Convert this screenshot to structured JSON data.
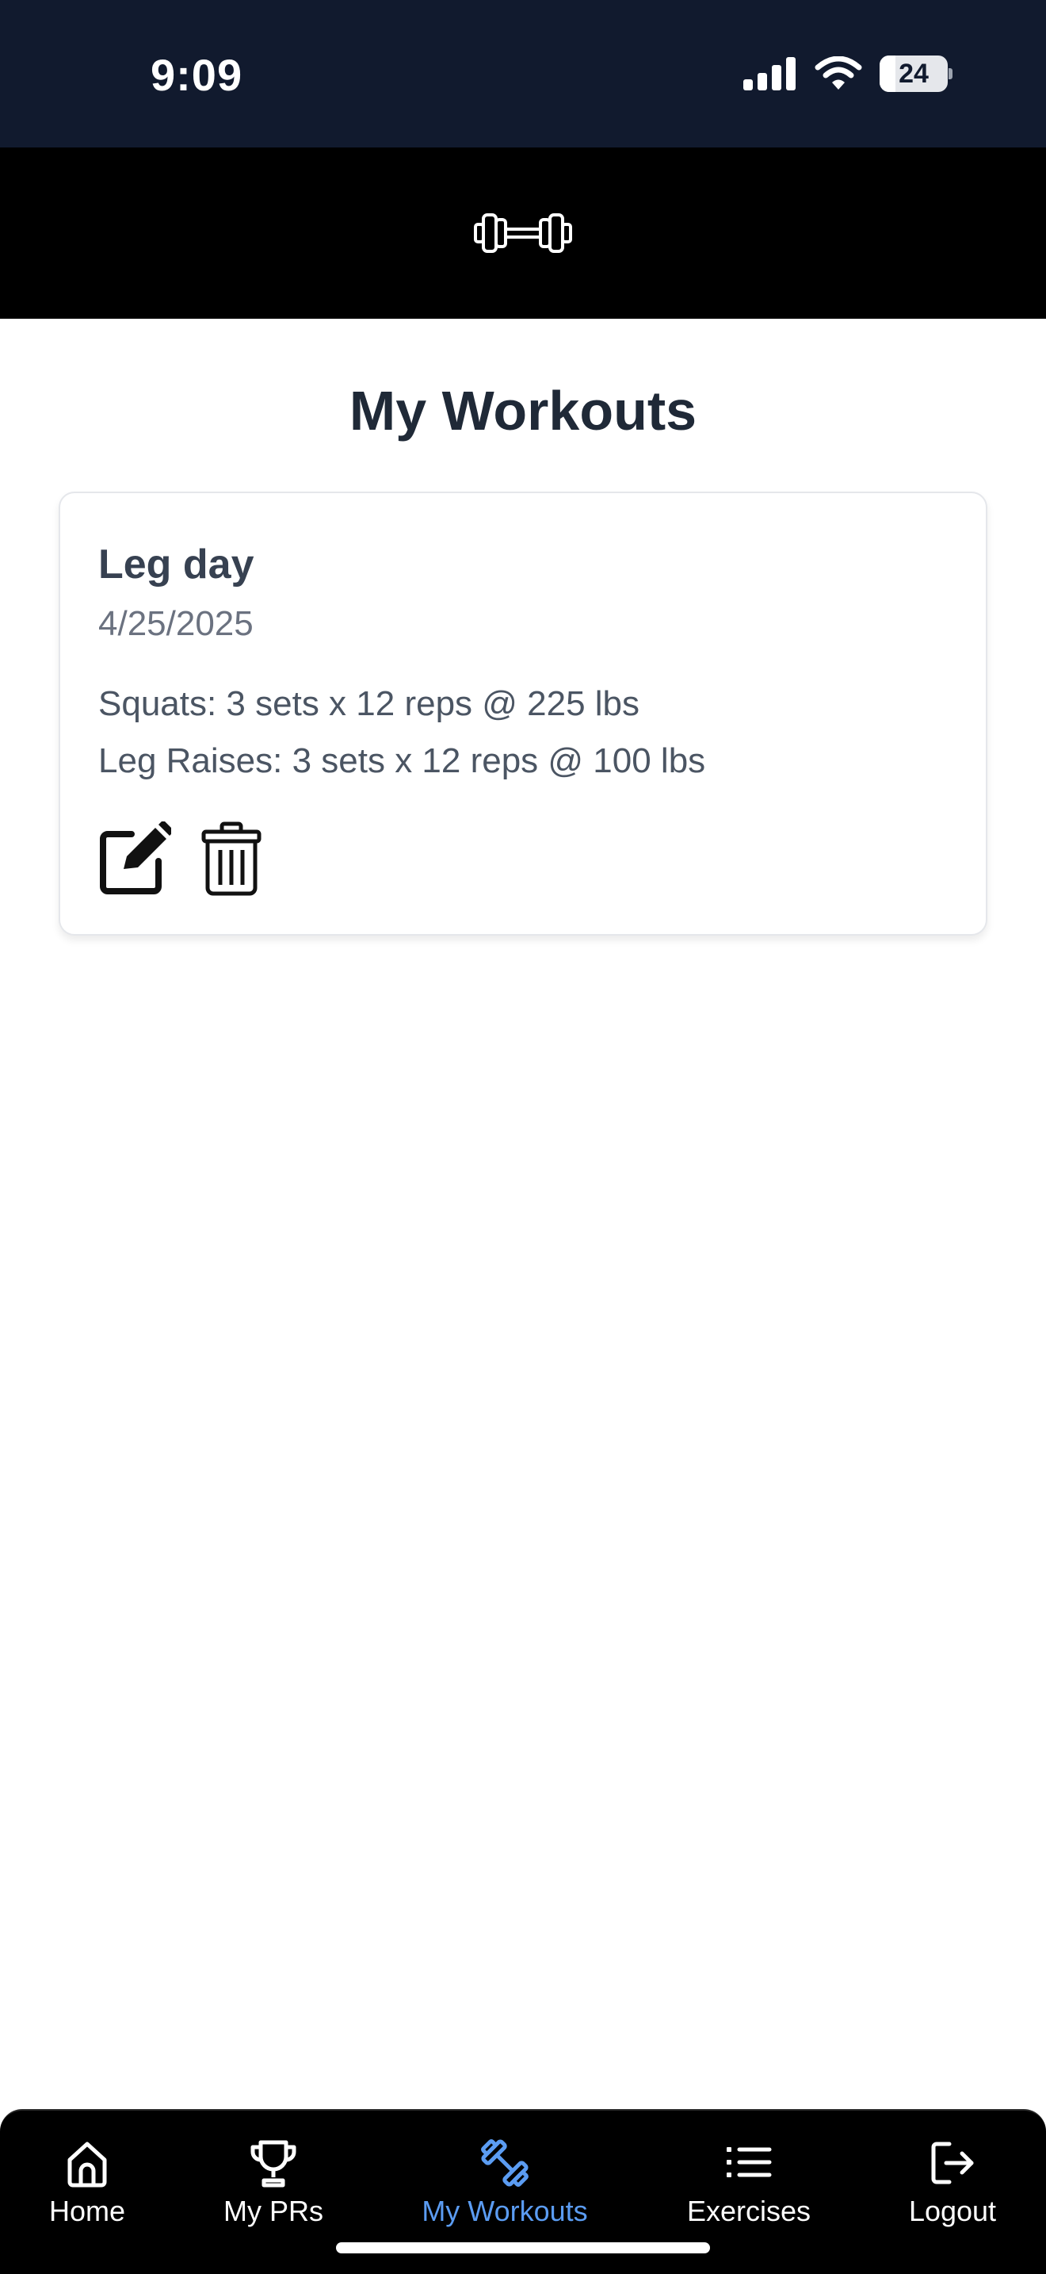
{
  "status_bar": {
    "time": "9:09",
    "battery_level": "24",
    "icons": [
      "signal-icon",
      "wifi-icon",
      "battery-icon"
    ]
  },
  "header": {
    "logo_icon": "dumbbell-icon"
  },
  "page": {
    "title": "My Workouts"
  },
  "workouts": [
    {
      "name": "Leg day",
      "date": "4/25/2025",
      "exercises": [
        "Squats: 3 sets x 12 reps @ 225 lbs",
        "Leg Raises: 3 sets x 12 reps @ 100 lbs"
      ],
      "actions": [
        "edit-icon",
        "trash-icon"
      ]
    }
  ],
  "bottom_nav": {
    "active_color": "#5b9cf2",
    "items": [
      {
        "label": "Home",
        "icon": "home-icon",
        "active": false
      },
      {
        "label": "My PRs",
        "icon": "trophy-icon",
        "active": false
      },
      {
        "label": "My Workouts",
        "icon": "dumbbell-icon",
        "active": true
      },
      {
        "label": "Exercises",
        "icon": "list-icon",
        "active": false
      },
      {
        "label": "Logout",
        "icon": "logout-icon",
        "active": false
      }
    ]
  },
  "colors": {
    "status_bar_bg": "#111a2e",
    "header_bg": "#000000",
    "title": "#1f2937",
    "muted_text": "#6b7280",
    "nav_active": "#5b9cf2"
  }
}
